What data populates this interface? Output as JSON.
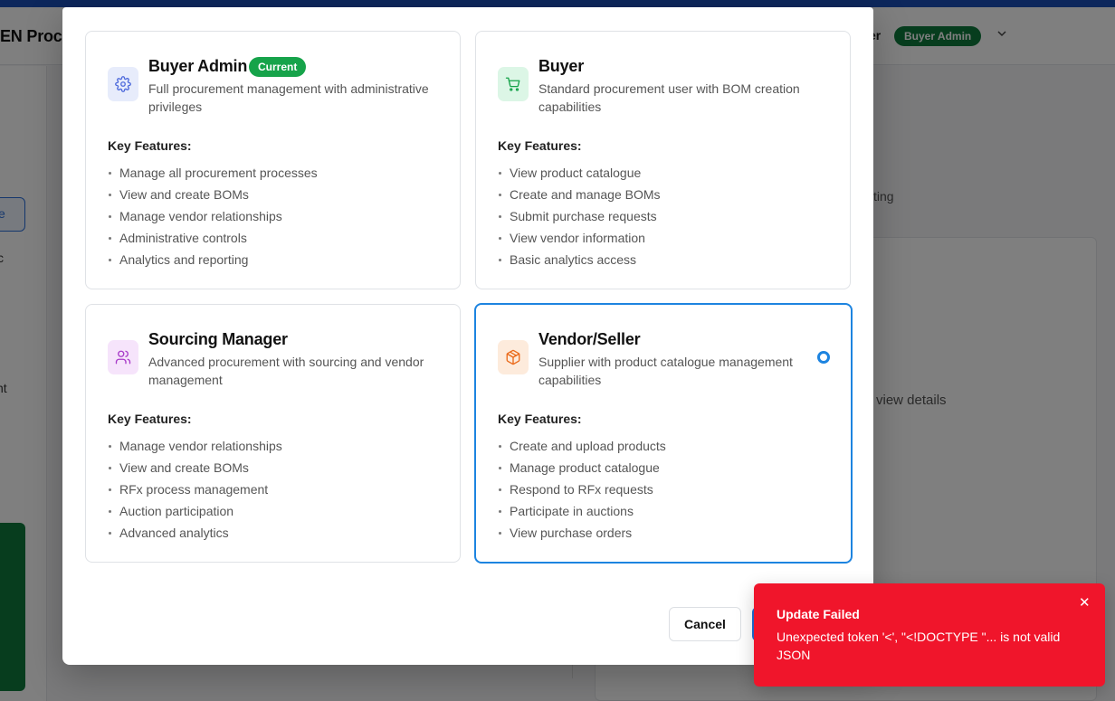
{
  "background": {
    "brand_text": "EN Procu",
    "user_label": "er",
    "role_badge": "Buyer Admin",
    "sidebar_snippets": [
      "e",
      "c",
      "nt"
    ],
    "tab_snippet": "ting",
    "details_snippet": "view details"
  },
  "modal": {
    "roles": [
      {
        "title": "Buyer Admin",
        "badge": "Current",
        "description": "Full procurement management with administrative privileges",
        "key_features_label": "Key Features:",
        "features": [
          "Manage all procurement processes",
          "View and create BOMs",
          "Manage vendor relationships",
          "Administrative controls",
          "Analytics and reporting"
        ],
        "icon": "gear-icon",
        "icon_color": "#4f6bdc",
        "icon_bg": "#e7ecfb"
      },
      {
        "title": "Buyer",
        "description": "Standard procurement user with BOM creation capabilities",
        "key_features_label": "Key Features:",
        "features": [
          "View product catalogue",
          "Create and manage BOMs",
          "Submit purchase requests",
          "View vendor information",
          "Basic analytics access"
        ],
        "icon": "shopping-cart-icon",
        "icon_color": "#16a34a",
        "icon_bg": "#dcf6e6"
      },
      {
        "title": "Sourcing Manager",
        "description": "Advanced procurement with sourcing and vendor management",
        "key_features_label": "Key Features:",
        "features": [
          "Manage vendor relationships",
          "View and create BOMs",
          "RFx process management",
          "Auction participation",
          "Advanced analytics"
        ],
        "icon": "users-icon",
        "icon_color": "#a83bc9",
        "icon_bg": "#f6e4fb"
      },
      {
        "title": "Vendor/Seller",
        "description": "Supplier with product catalogue management capabilities",
        "key_features_label": "Key Features:",
        "features": [
          "Create and upload products",
          "Manage product catalogue",
          "Respond to RFx requests",
          "Participate in auctions",
          "View purchase orders"
        ],
        "icon": "package-icon",
        "icon_color": "#ea6a1a",
        "icon_bg": "#fdebdc",
        "selected": true
      }
    ],
    "cancel_label": "Cancel",
    "accent_color": "#1d84e0"
  },
  "toast": {
    "title": "Update Failed",
    "message": "Unexpected token '<', \"<!DOCTYPE \"... is not valid JSON",
    "close_glyph": "✕",
    "color": "#f0152b"
  }
}
